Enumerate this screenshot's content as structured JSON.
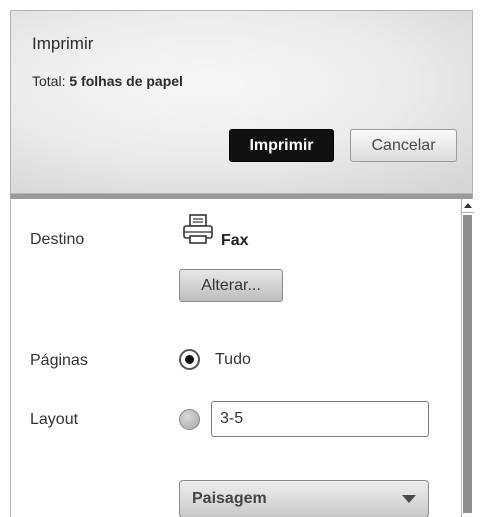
{
  "header": {
    "title": "Imprimir",
    "total_prefix": "Total:",
    "total_value": "5 folhas de papel",
    "print_button": "Imprimir",
    "cancel_button": "Cancelar"
  },
  "destination": {
    "label": "Destino",
    "icon": "printer-icon",
    "value": "Fax",
    "change_button": "Alterar..."
  },
  "pages": {
    "label": "Páginas",
    "option_all": "Tudo",
    "option_all_selected": true,
    "range_value": "3-5"
  },
  "layout": {
    "label": "Layout",
    "selected": "Paisagem"
  }
}
